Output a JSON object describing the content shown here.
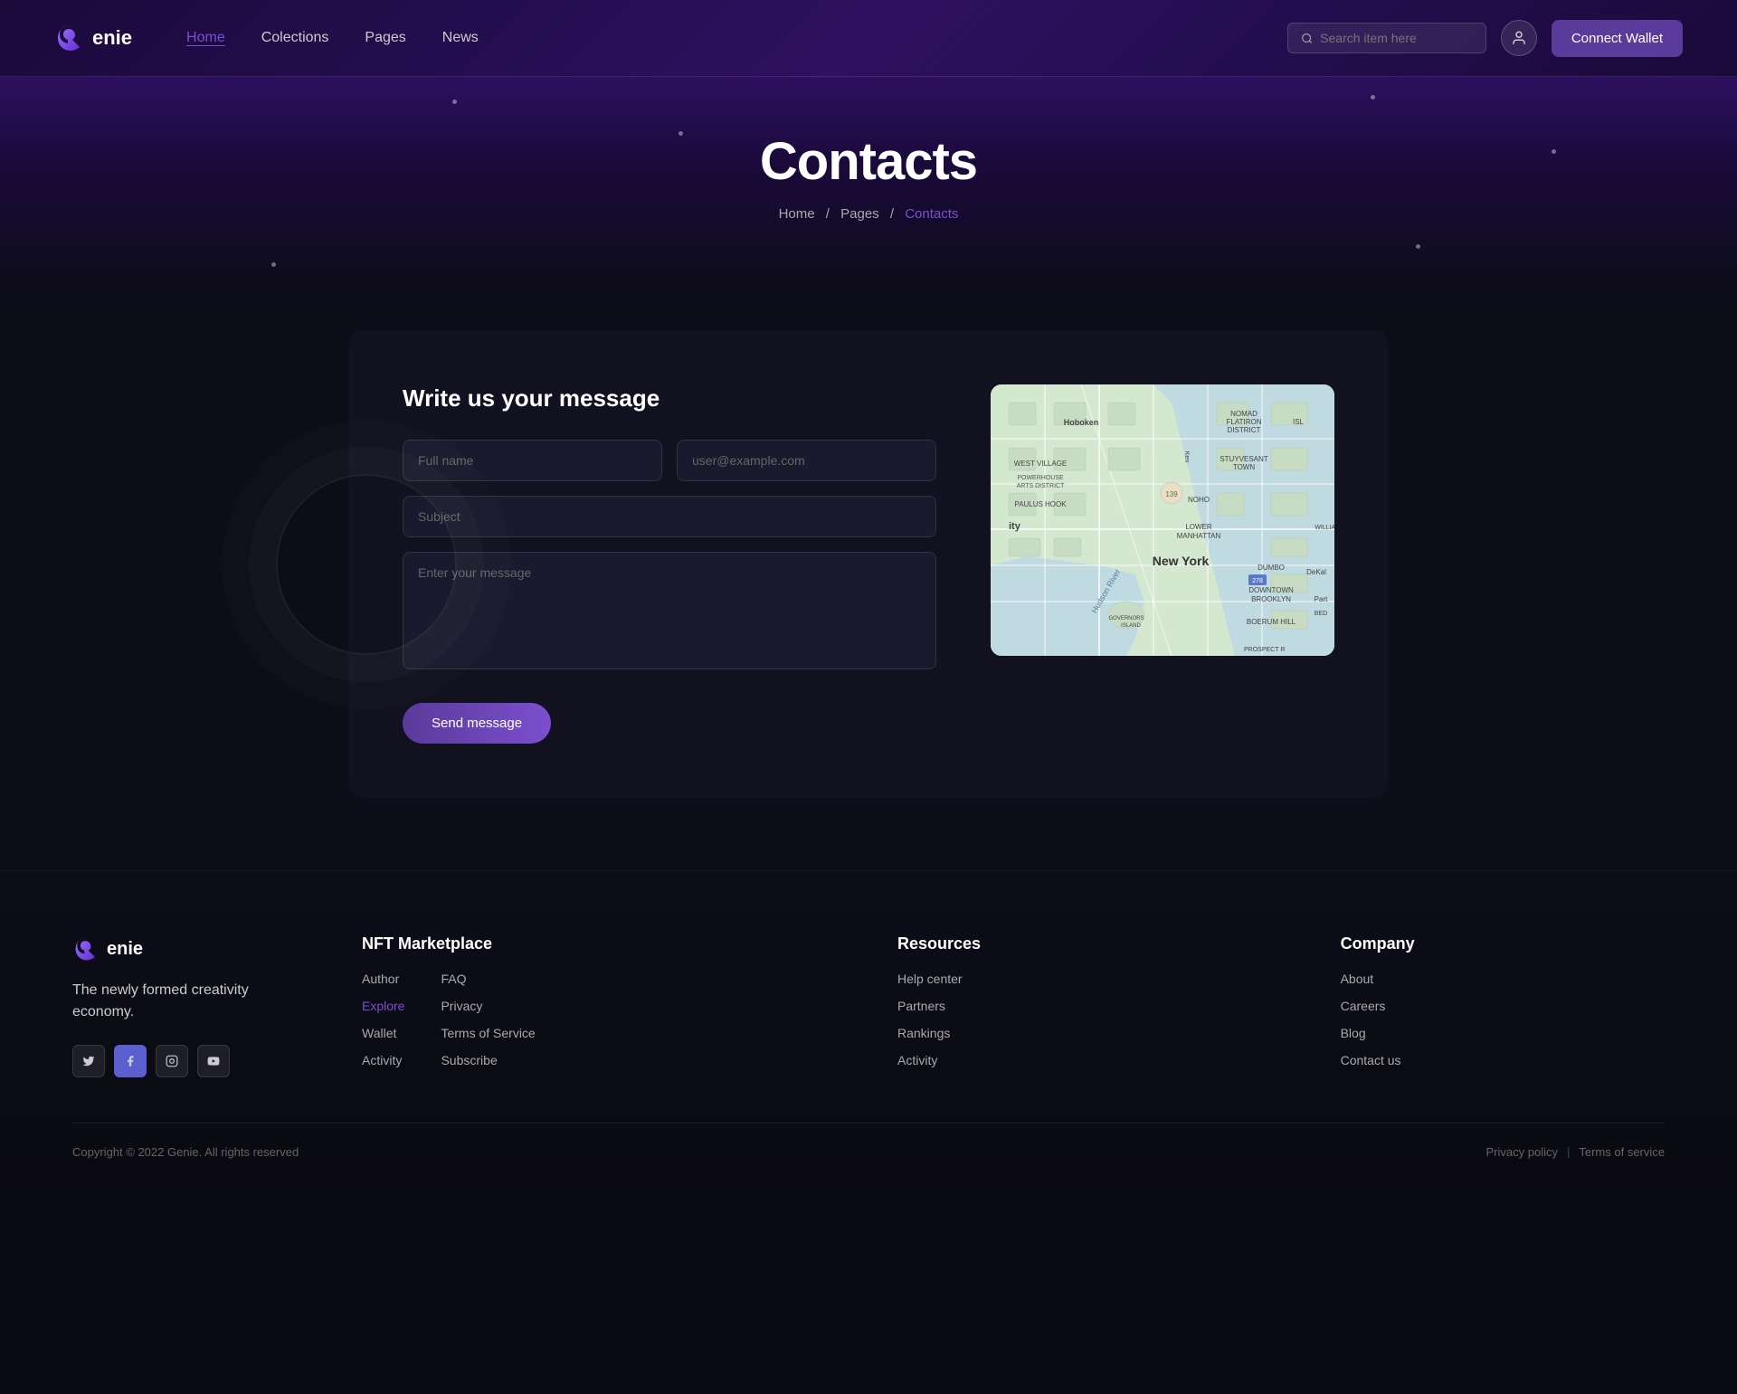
{
  "header": {
    "logo_text": "enie",
    "nav": [
      {
        "label": "Home",
        "active": true
      },
      {
        "label": "Colections",
        "active": false
      },
      {
        "label": "Pages",
        "active": false
      },
      {
        "label": "News",
        "active": false
      }
    ],
    "search_placeholder": "Search item here",
    "connect_wallet_label": "Connect Wallet"
  },
  "hero": {
    "title": "Contacts",
    "breadcrumb": [
      {
        "label": "Home",
        "link": true
      },
      {
        "label": "Pages",
        "link": true
      },
      {
        "label": "Contacts",
        "link": false,
        "current": true
      }
    ]
  },
  "contact": {
    "form_title": "Write us your message",
    "full_name_placeholder": "Full name",
    "email_placeholder": "user@example.com",
    "subject_placeholder": "Subject",
    "message_placeholder": "Enter your message",
    "send_button": "Send message"
  },
  "footer": {
    "logo_text": "enie",
    "tagline": "The newly formed creativity economy.",
    "social": [
      {
        "icon": "twitter",
        "label": "Twitter"
      },
      {
        "icon": "facebook",
        "label": "Facebook"
      },
      {
        "icon": "instagram",
        "label": "Instagram"
      },
      {
        "icon": "youtube",
        "label": "YouTube"
      }
    ],
    "nft_marketplace": {
      "title": "NFT Marketplace",
      "col1": [
        {
          "label": "Author",
          "active": false
        },
        {
          "label": "Explore",
          "active": true
        },
        {
          "label": "Wallet",
          "active": false
        },
        {
          "label": "Activity",
          "active": false
        }
      ],
      "col2": [
        {
          "label": "FAQ",
          "active": false
        },
        {
          "label": "Privacy",
          "active": false
        },
        {
          "label": "Terms of Service",
          "active": false
        },
        {
          "label": "Subscribe",
          "active": false
        }
      ]
    },
    "resources": {
      "title": "Resources",
      "links": [
        {
          "label": "Help center"
        },
        {
          "label": "Partners"
        },
        {
          "label": "Rankings"
        },
        {
          "label": "Activity"
        }
      ]
    },
    "company": {
      "title": "Company",
      "links": [
        {
          "label": "About"
        },
        {
          "label": "Careers"
        },
        {
          "label": "Blog"
        },
        {
          "label": "Contact us"
        }
      ]
    },
    "copyright": "Copyright © 2022  Genie. All rights reserved",
    "privacy_policy": "Privacy policy",
    "terms_of_service": "Terms of service"
  }
}
